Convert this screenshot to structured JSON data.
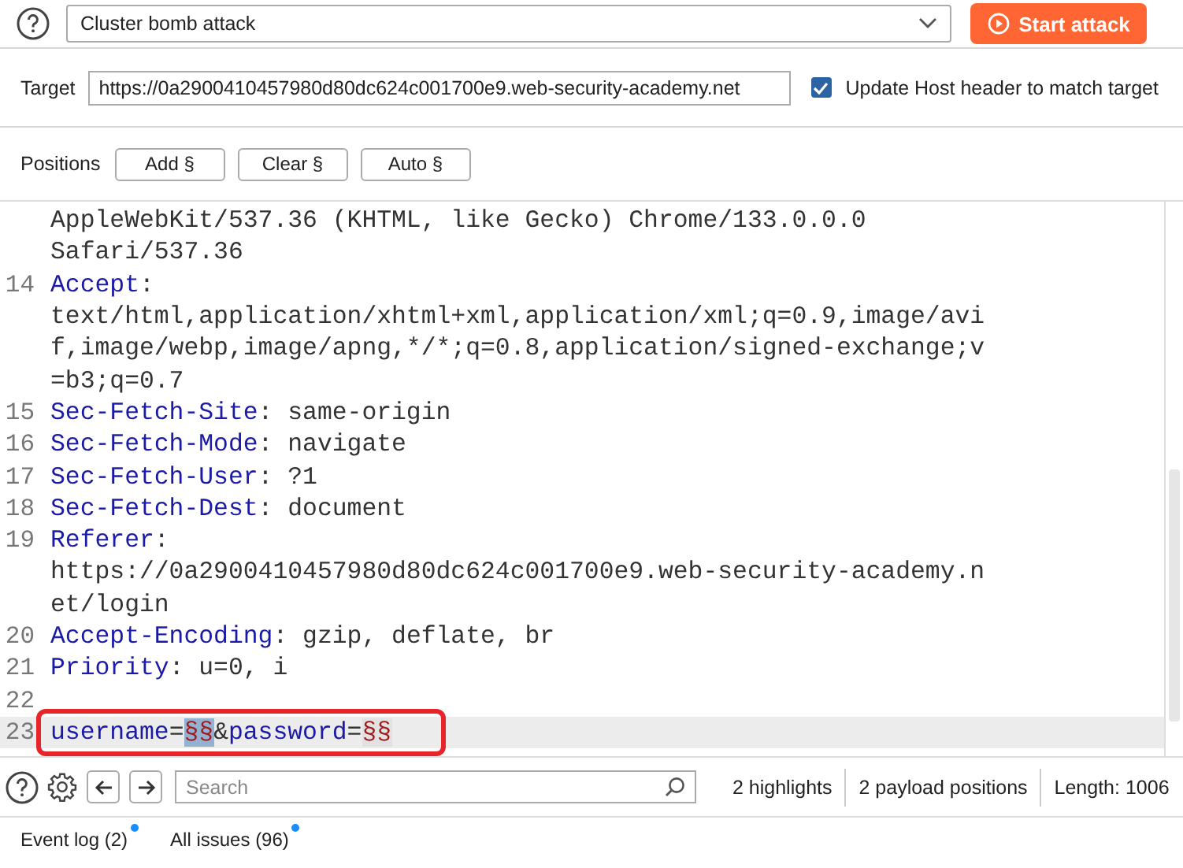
{
  "attack_bar": {
    "attack_type": "Cluster bomb attack",
    "start_button": "Start attack"
  },
  "target": {
    "label": "Target",
    "value": "https://0a2900410457980d80dc624c001700e9.web-security-academy.net",
    "update_host": {
      "label": "Update Host header to match target",
      "checked": true
    }
  },
  "positions": {
    "label": "Positions",
    "buttons": [
      "Add §",
      "Clear §",
      "Auto §"
    ]
  },
  "editor": {
    "rows": [
      {
        "parts": [
          {
            "kind": "plain",
            "text": "AppleWebKit/537.36 (KHTML, like Gecko) Chrome/133.0.0.0"
          }
        ]
      },
      {
        "parts": [
          {
            "kind": "plain",
            "text": "Safari/537.36"
          }
        ]
      },
      {
        "number": "14",
        "parts": [
          {
            "kind": "key",
            "text": "Accept"
          },
          {
            "kind": "plain",
            "text": ":"
          }
        ]
      },
      {
        "parts": [
          {
            "kind": "plain",
            "text": "text/html,application/xhtml+xml,application/xml;q=0.9,image/avi"
          }
        ]
      },
      {
        "parts": [
          {
            "kind": "plain",
            "text": "f,image/webp,image/apng,*/*;q=0.8,application/signed-exchange;v"
          }
        ]
      },
      {
        "parts": [
          {
            "kind": "plain",
            "text": "=b3;q=0.7"
          }
        ]
      },
      {
        "number": "15",
        "parts": [
          {
            "kind": "key",
            "text": "Sec-Fetch-Site"
          },
          {
            "kind": "plain",
            "text": ": same-origin"
          }
        ]
      },
      {
        "number": "16",
        "parts": [
          {
            "kind": "key",
            "text": "Sec-Fetch-Mode"
          },
          {
            "kind": "plain",
            "text": ": navigate"
          }
        ]
      },
      {
        "number": "17",
        "parts": [
          {
            "kind": "key",
            "text": "Sec-Fetch-User"
          },
          {
            "kind": "plain",
            "text": ": ?1"
          }
        ]
      },
      {
        "number": "18",
        "parts": [
          {
            "kind": "key",
            "text": "Sec-Fetch-Dest"
          },
          {
            "kind": "plain",
            "text": ": document"
          }
        ]
      },
      {
        "number": "19",
        "parts": [
          {
            "kind": "key",
            "text": "Referer"
          },
          {
            "kind": "plain",
            "text": ":"
          }
        ]
      },
      {
        "parts": [
          {
            "kind": "plain",
            "text": "https://0a2900410457980d80dc624c001700e9.web-security-academy.n"
          }
        ]
      },
      {
        "parts": [
          {
            "kind": "plain",
            "text": "et/login"
          }
        ]
      },
      {
        "number": "20",
        "parts": [
          {
            "kind": "key",
            "text": "Accept-Encoding"
          },
          {
            "kind": "plain",
            "text": ": gzip, deflate, br"
          }
        ]
      },
      {
        "number": "21",
        "parts": [
          {
            "kind": "key",
            "text": "Priority"
          },
          {
            "kind": "plain",
            "text": ": u=0, i"
          }
        ]
      },
      {
        "number": "22",
        "parts": []
      },
      {
        "number": "23",
        "current": true,
        "outlined": true,
        "parts": [
          {
            "kind": "key",
            "text": "username"
          },
          {
            "kind": "plain",
            "text": "="
          },
          {
            "kind": "marker",
            "text": "§§",
            "selected": true
          },
          {
            "kind": "plain",
            "text": "&"
          },
          {
            "kind": "key",
            "text": "password"
          },
          {
            "kind": "plain",
            "text": "="
          },
          {
            "kind": "marker",
            "text": "§§",
            "selected": false
          }
        ]
      }
    ]
  },
  "toolbar": {
    "search_placeholder": "Search",
    "highlights": "2 highlights",
    "payload_positions": "2 payload positions",
    "length": "Length: 1006"
  },
  "footer": [
    {
      "label": "Event log (2)",
      "has_new": true
    },
    {
      "label": "All issues (96)",
      "has_new": true
    }
  ]
}
